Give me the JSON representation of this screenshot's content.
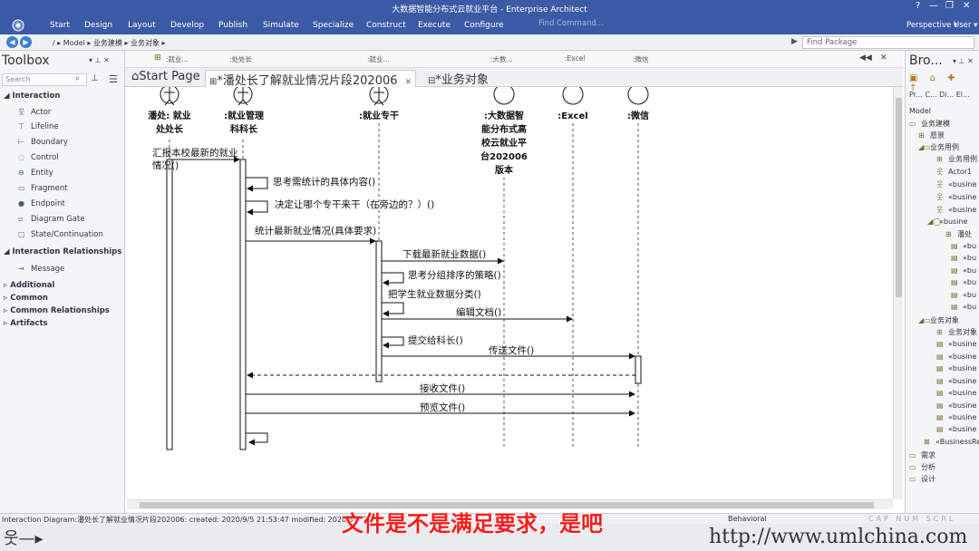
{
  "window": {
    "title": "大数据智能分布式云就业平台 - Enterprise Architect",
    "controls": [
      "?",
      "—",
      "❐",
      "✕"
    ]
  },
  "ribbon": {
    "menus": [
      "Start",
      "Design",
      "Layout",
      "Develop",
      "Publish",
      "Simulate",
      "Specialize",
      "Construct",
      "Execute",
      "Configure"
    ],
    "find_command_placeholder": "Find Command...",
    "perspective": "Perspective ▾",
    "user": "User ▾"
  },
  "address": {
    "path": "/  ▸ Model ▸ 业务建模 ▸ 业务对象 ▸",
    "find_package_placeholder": "Find Package"
  },
  "toolbox": {
    "title": "Toolbox",
    "search_placeholder": "Search",
    "sections": [
      {
        "label": "Interaction",
        "items": [
          "Actor",
          "Lifeline",
          "Boundary",
          "Control",
          "Entity",
          "Fragment",
          "Endpoint",
          "Diagram Gate",
          "State/Continuation"
        ]
      },
      {
        "label": "Interaction Relationships",
        "items": [
          "Message"
        ]
      },
      {
        "label": "Additional",
        "items": []
      },
      {
        "label": "Common",
        "items": []
      },
      {
        "label": "Common Relationships",
        "items": []
      },
      {
        "label": "Artifacts",
        "items": []
      }
    ]
  },
  "tabs": [
    {
      "label": "Start Page"
    },
    {
      "label": "*潘处长了解就业情况片段202006"
    },
    {
      "label": "*业务对象"
    }
  ],
  "lifeline_headers_bar": [
    ":就业...",
    ":处处长",
    ":就业...",
    ":大数...",
    ":Excel",
    ":微信"
  ],
  "lifelines": [
    {
      "name": "潘处: 就业\n处处长"
    },
    {
      "name": ":就业管理\n科科长"
    },
    {
      "name": ":就业专干"
    },
    {
      "name": ":大数据智\n能分布式高\n校云就业平\n台202006\n版本"
    },
    {
      "name": ":Excel"
    },
    {
      "name": ":微信"
    }
  ],
  "messages": [
    {
      "label": "汇报本校最新的就业\n情况()"
    },
    {
      "label": "思考需统计的具体内容()"
    },
    {
      "label": "决定让哪个专干来干（在旁边的？）()"
    },
    {
      "label": "统计最新就业情况(具体要求)"
    },
    {
      "label": "下载最新就业数据()"
    },
    {
      "label": "思考分组排序的策略()"
    },
    {
      "label": "把学生就业数据分类()"
    },
    {
      "label": "编辑文档()"
    },
    {
      "label": "提交给科长()"
    },
    {
      "label": "传送文件()"
    },
    {
      "label": "接收文件()"
    },
    {
      "label": "预览文件()"
    }
  ],
  "browser": {
    "title": "Bro...",
    "subtabs": "Pr...  C...  Di...  El...",
    "root": "Model",
    "tree": [
      {
        "label": "业务建模"
      },
      {
        "label": "愿景"
      },
      {
        "label": "业务用例"
      },
      {
        "label": "业务用例"
      },
      {
        "label": "Actor1"
      },
      {
        "label": "«busine"
      },
      {
        "label": "«busine"
      },
      {
        "label": "«busine"
      },
      {
        "label": "«busine"
      },
      {
        "label": "潘处"
      },
      {
        "label": "«bu"
      },
      {
        "label": "«bu"
      },
      {
        "label": "«bu"
      },
      {
        "label": "«bu"
      },
      {
        "label": "«bu"
      },
      {
        "label": "«bu"
      },
      {
        "label": "业务对象"
      },
      {
        "label": "业务对象"
      },
      {
        "label": "«busine"
      },
      {
        "label": "«busine"
      },
      {
        "label": "«busine"
      },
      {
        "label": "«busine"
      },
      {
        "label": "«busine"
      },
      {
        "label": "«busine"
      },
      {
        "label": "«busine"
      },
      {
        "label": "«busine"
      },
      {
        "label": "«BusinessRe"
      },
      {
        "label": "需求"
      },
      {
        "label": "分析"
      },
      {
        "label": "设计"
      }
    ]
  },
  "status": {
    "text": "Interaction Diagram:潘处长了解就业情况片段202006:  created: 2020/9/5 21:53:47  modified: 2020/9/6 18",
    "mode": "Behavioral",
    "keys": "CAP  NUM  SCRL  CLOUD"
  },
  "caption": "文件是不是满足要求，是吧",
  "watermark": "http://www.umlchina.com"
}
